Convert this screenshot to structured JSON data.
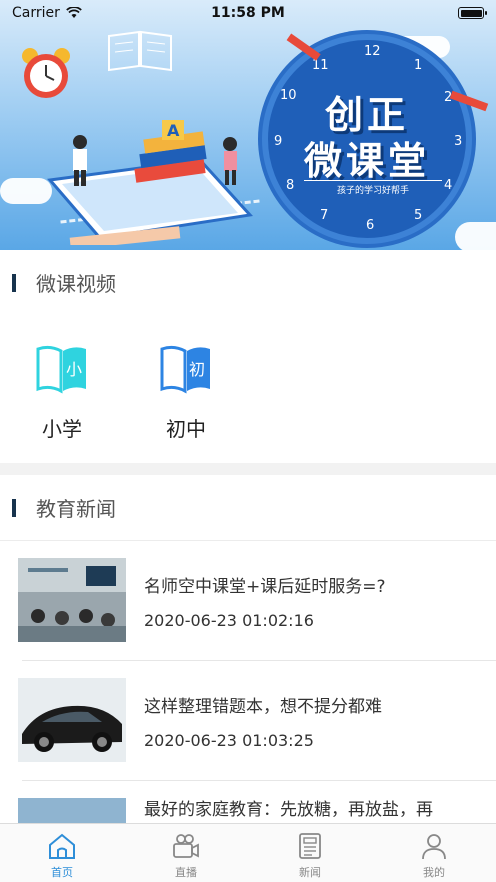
{
  "status_bar": {
    "carrier": "Carrier",
    "time": "11:58 PM"
  },
  "banner": {
    "title_line1": "创正",
    "title_line2": "微课堂",
    "slogan": "孩子的学习好帮手",
    "clock_numbers": [
      "12",
      "1",
      "2",
      "3",
      "4",
      "5",
      "6",
      "7",
      "8",
      "9",
      "10",
      "11"
    ],
    "book_letter": "A"
  },
  "video_section": {
    "title": "微课视频",
    "grades": [
      {
        "label": "小学",
        "icon_char": "小",
        "color": "#2fd3df"
      },
      {
        "label": "初中",
        "icon_char": "初",
        "color": "#2d84e3"
      }
    ]
  },
  "news_section": {
    "title": "教育新闻",
    "items": [
      {
        "title": "名师空中课堂+课后延时服务=?",
        "date": "2020-06-23 01:02:16",
        "thumb": "classroom-photo"
      },
      {
        "title": "这样整理错题本，想不提分都难",
        "date": "2020-06-23 01:03:25",
        "thumb": "black-car-photo"
      },
      {
        "title": "最好的家庭教育：先放糖，再放盐，再",
        "date": "",
        "thumb": "photo"
      }
    ]
  },
  "tab_bar": {
    "active_color": "#2e8ed8",
    "tabs": [
      {
        "label": "首页",
        "icon": "home-icon"
      },
      {
        "label": "直播",
        "icon": "video-camera-icon"
      },
      {
        "label": "新闻",
        "icon": "newspaper-icon"
      },
      {
        "label": "我的",
        "icon": "user-icon"
      }
    ]
  }
}
